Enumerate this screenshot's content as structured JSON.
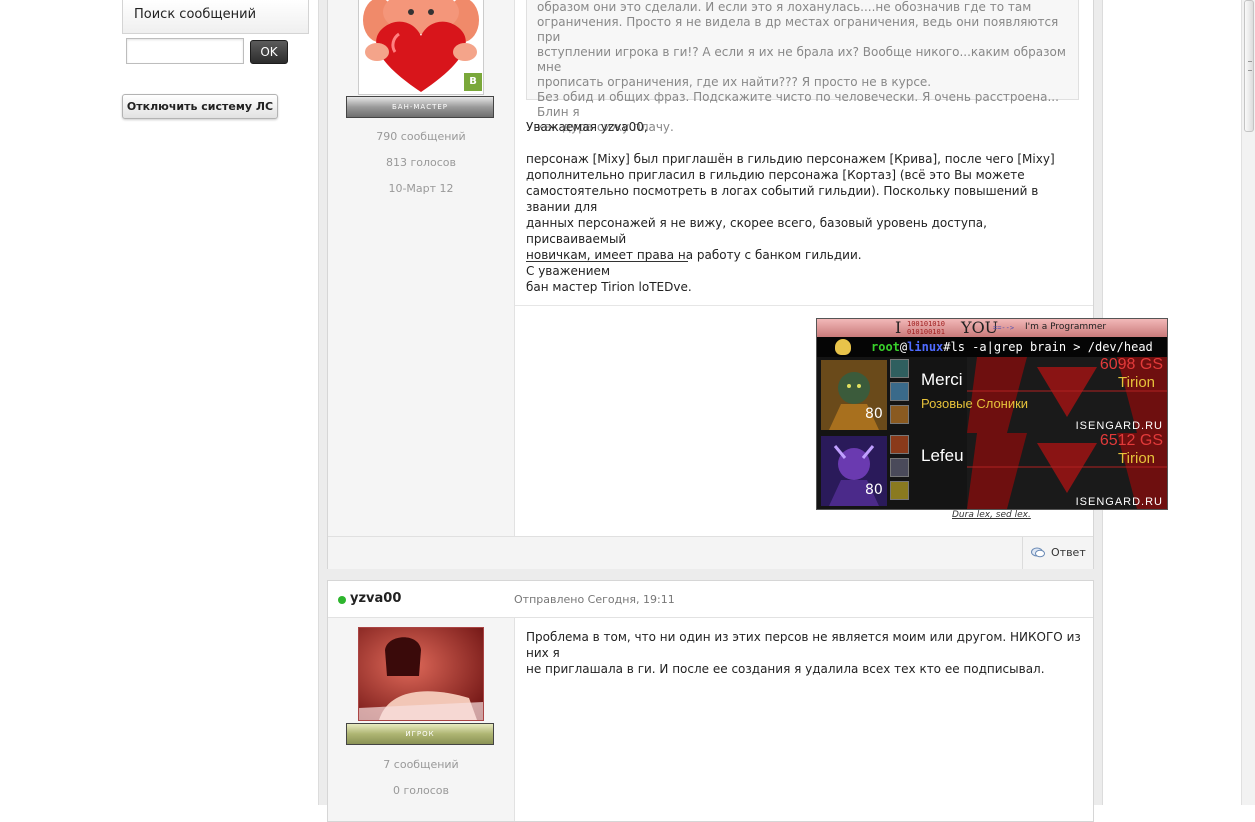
{
  "sidebar": {
    "search_title": "Поиск сообщений",
    "search_value": "",
    "ok_label": "OK",
    "disable_pm_label": "Отключить систему ЛС"
  },
  "post1": {
    "rank": "бан-мастер",
    "badge": "В",
    "messages": "790 сообщений",
    "votes": "813 голосов",
    "joined": "10-Март 12",
    "quote_lines": [
      "образом они это сделали. И если это я лоханулась....не обозначив где то там",
      "ограничения. Просто я не видела в др местах ограничения, ведь они появляются при",
      "вступлении игрока в ги!? А если я их не брала их? Вообще никого...каким образом мне",
      "прописать ограничения, где их найти??? Я просто не в курсе.",
      "Без обид и общих фраз. Подскажите чисто по человечески. Я очень расстроена... Блин я",
      "как дура сижу плачу."
    ],
    "greeting": "Уважаемая yzva00,",
    "body_lines": [
      "персонаж [Mixy] был приглашён в гильдию персонажем [Крива], после чего [Mixy]",
      "дополнительно пригласил в гильдию персонажа [Кортаз] (всё это Вы можете",
      "самостоятельно посмотреть в логах событий гильдии). Поскольку повышений в звании для",
      "данных персонажей я не вижу, скорее всего, базовый уровень доступа, присваиваемый",
      "новичкам, имеет права на работу с банком гильдии."
    ],
    "regards": "С уважением",
    "sign": "бан мастер Tirion loTEDve.",
    "reply_label": "Ответ"
  },
  "banner": {
    "i_letter": "I",
    "bin_top": "100101010",
    "bin_bottom": "010100101",
    "you": "YOU",
    "programmer": "I'm a Programmer",
    "cmd_user": "root",
    "cmd_at": "@",
    "cmd_host": "linux",
    "cmd_rest": "#ls -a|grep brain > /dev/head",
    "characters": [
      {
        "name": "Merci",
        "guild": "Розовые Слоники",
        "gs": "6098 GS",
        "realm": "Tirion",
        "level": "80",
        "site": "ISENGARD.RU"
      },
      {
        "name": "Lefeu",
        "guild": "",
        "gs": "6512 GS",
        "realm": "Tirion",
        "level": "80",
        "site": "ISENGARD.RU"
      }
    ],
    "motto": "Dura lex, sed lex."
  },
  "post2": {
    "author": "yzva00",
    "posted": "Отправлено Сегодня, 19:11",
    "rank": "игрок",
    "messages": "7 сообщений",
    "votes": "0 голосов",
    "body_lines": [
      "Проблема в том, что ни один из этих персов не является  моим или другом. НИКОГО из них я",
      "не приглашала в ги. И после ее создания я удалила всех тех кто ее подписывал."
    ]
  },
  "colors": {
    "online": "#2db52d",
    "gs_red": "#e23a3a",
    "realm_gold": "#e6c23a"
  }
}
